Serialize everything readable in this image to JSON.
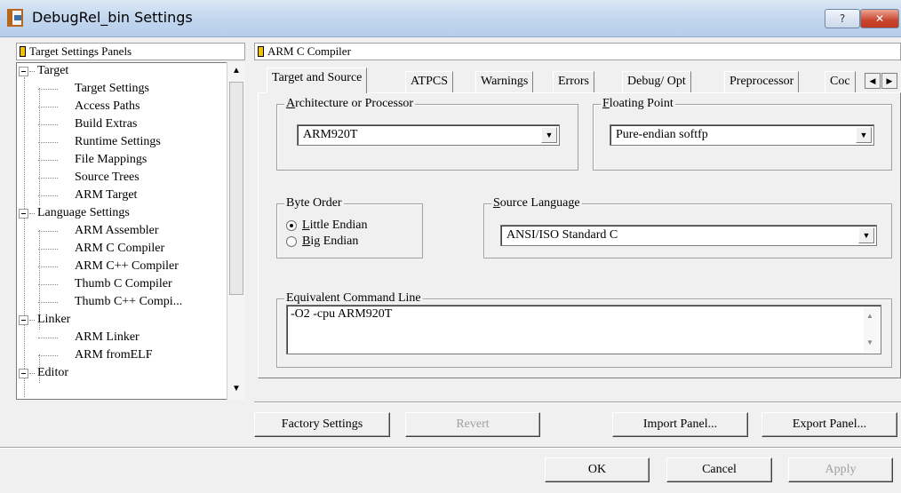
{
  "window": {
    "title": "DebugRel_bin Settings",
    "help_label": "?",
    "close_label": "✕"
  },
  "tree": {
    "header": "Target Settings Panels",
    "rows": [
      {
        "label": "Target",
        "level": 0
      },
      {
        "label": "Target Settings",
        "level": 1
      },
      {
        "label": "Access Paths",
        "level": 1
      },
      {
        "label": "Build Extras",
        "level": 1
      },
      {
        "label": "Runtime Settings",
        "level": 1
      },
      {
        "label": "File Mappings",
        "level": 1
      },
      {
        "label": "Source Trees",
        "level": 1
      },
      {
        "label": "ARM Target",
        "level": 1
      },
      {
        "label": "Language Settings",
        "level": 0
      },
      {
        "label": "ARM Assembler",
        "level": 1
      },
      {
        "label": "ARM C Compiler",
        "level": 1
      },
      {
        "label": "ARM C++ Compiler",
        "level": 1
      },
      {
        "label": "Thumb C Compiler",
        "level": 1
      },
      {
        "label": "Thumb C++ Compi...",
        "level": 1
      },
      {
        "label": "Linker",
        "level": 0
      },
      {
        "label": "ARM Linker",
        "level": 1
      },
      {
        "label": "ARM fromELF",
        "level": 1
      },
      {
        "label": "Editor",
        "level": 0
      }
    ]
  },
  "panel": {
    "header": "ARM C Compiler",
    "tabs": [
      {
        "label": "Target and Source",
        "active": true
      },
      {
        "label": "ATPCS"
      },
      {
        "label": "Warnings"
      },
      {
        "label": "Errors"
      },
      {
        "label": "Debug/ Opt"
      },
      {
        "label": "Preprocessor"
      },
      {
        "label": "Coc"
      }
    ]
  },
  "architecture": {
    "legend_key": "A",
    "legend_rest": "rchitecture or Processor",
    "value": "ARM920T"
  },
  "floating_point": {
    "legend_key": "F",
    "legend_rest": "loating Point",
    "value": "Pure-endian softfp"
  },
  "byte_order": {
    "legend": "Byte Order",
    "options": [
      {
        "key": "L",
        "rest": "ittle Endian",
        "selected": true
      },
      {
        "key": "B",
        "rest": "ig Endian",
        "selected": false
      }
    ]
  },
  "source_language": {
    "legend_key": "S",
    "legend_rest": "ource Language",
    "value": "ANSI/ISO Standard C"
  },
  "command_line": {
    "legend": "Equivalent Command Line",
    "value": "-O2 -cpu ARM920T"
  },
  "buttons": {
    "factory": "Factory Settings",
    "revert": "Revert",
    "import": "Import Panel...",
    "export": "Export Panel...",
    "ok": "OK",
    "cancel": "Cancel",
    "apply": "Apply"
  }
}
